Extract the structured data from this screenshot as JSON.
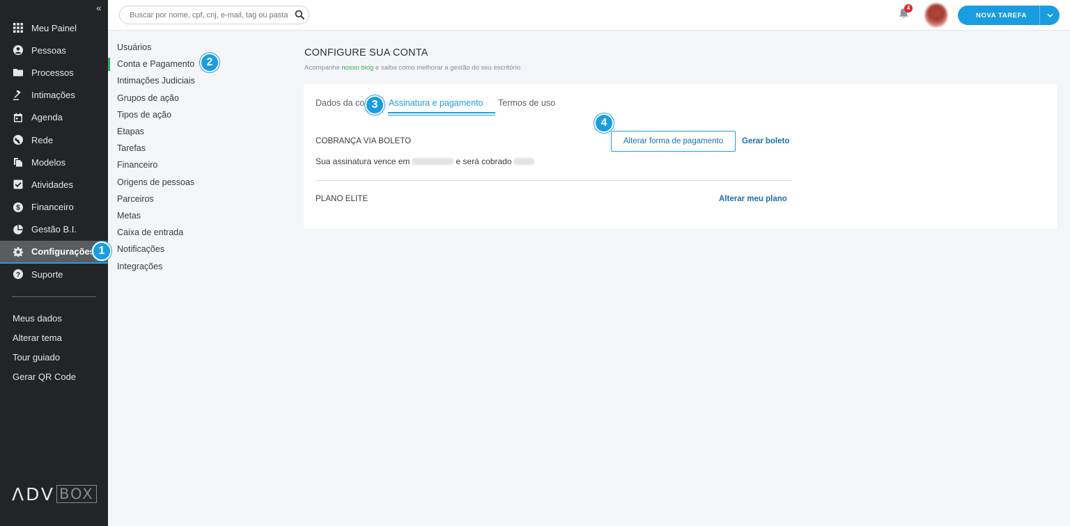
{
  "sidebar": {
    "collapse_glyph": "«",
    "items": [
      {
        "label": "Meu Painel",
        "icon": "grid-icon"
      },
      {
        "label": "Pessoas",
        "icon": "user-icon"
      },
      {
        "label": "Processos",
        "icon": "folder-icon"
      },
      {
        "label": "Intimações",
        "icon": "gavel-icon"
      },
      {
        "label": "Agenda",
        "icon": "calendar-icon"
      },
      {
        "label": "Rede",
        "icon": "globe-icon"
      },
      {
        "label": "Modelos",
        "icon": "files-icon"
      },
      {
        "label": "Atividades",
        "icon": "checkbox-icon"
      },
      {
        "label": "Financeiro",
        "icon": "dollar-icon"
      },
      {
        "label": "Gestão B.I.",
        "icon": "pie-chart-icon"
      },
      {
        "label": "Configurações",
        "icon": "gear-icon",
        "active": true
      },
      {
        "label": "Suporte",
        "icon": "help-icon"
      }
    ],
    "links": [
      "Meus dados",
      "Alterar tema",
      "Tour guiado",
      "Gerar QR Code"
    ],
    "logo": {
      "left": "ΛDV",
      "right": "BOX"
    }
  },
  "topbar": {
    "search_placeholder": "Buscar por nome, cpf, cnj, e-mail, tag ou pasta",
    "notification_count": "4",
    "new_task_label": "NOVA TAREFA"
  },
  "submenu": {
    "items": [
      "Usuários",
      "Conta e Pagamento",
      "Intimações Judiciais",
      "Grupos de ação",
      "Tipos de ação",
      "Etapas",
      "Tarefas",
      "Financeiro",
      "Origens de pessoas",
      "Parceiros",
      "Metas",
      "Caixa de entrada",
      "Notificações",
      "Integrações"
    ],
    "active_index": 1
  },
  "main": {
    "title": "CONFIGURE SUA CONTA",
    "subtitle_pre": "Acompanhe ",
    "subtitle_link": "nosso blog",
    "subtitle_post": " e saiba como melhorar a gestão do seu escritório",
    "tabs": {
      "tab1": "Dados da co",
      "tab2": "Assinatura e pagamento",
      "tab3": "Termos de uso"
    },
    "boleto_title": "COBRANÇA VIA BOLETO",
    "change_payment_button": "Alterar forma de pagamento",
    "generate_boleto_link": "Gerar boleto",
    "info_pre": "Sua assinatura vence em",
    "info_mid": "e será cobrado",
    "plan_title": "PLANO ELITE",
    "change_plan_link": "Alterar meu plano"
  },
  "steps": {
    "s1": "1",
    "s2": "2",
    "s3": "3",
    "s4": "4"
  },
  "colors": {
    "accent": "#1a9de0",
    "active_green": "#2ab25c",
    "sidebar_bg": "#232427",
    "badge": "#e0262d"
  }
}
